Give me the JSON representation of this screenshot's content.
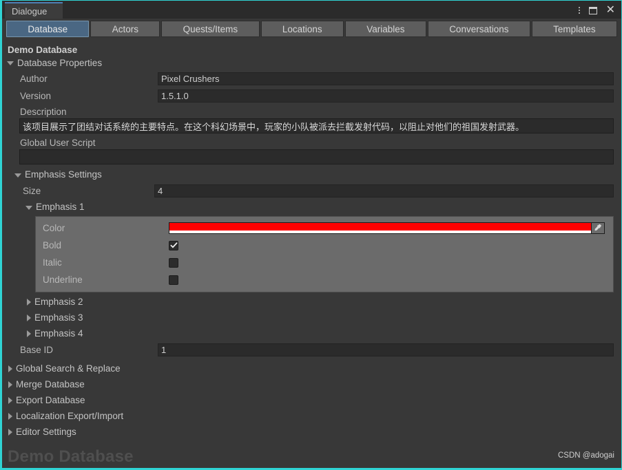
{
  "window": {
    "tab_label": "Dialogue",
    "controls": {
      "menu_icon": "kebab-menu-icon",
      "maximize_icon": "maximize-icon",
      "close_icon": "close-icon"
    }
  },
  "tabs": [
    {
      "label": "Database",
      "active": true
    },
    {
      "label": "Actors",
      "active": false
    },
    {
      "label": "Quests/Items",
      "active": false
    },
    {
      "label": "Locations",
      "active": false
    },
    {
      "label": "Variables",
      "active": false
    },
    {
      "label": "Conversations",
      "active": false
    },
    {
      "label": "Templates",
      "active": false
    }
  ],
  "database": {
    "title": "Demo Database",
    "properties_foldout": "Database Properties",
    "author": {
      "label": "Author",
      "value": "Pixel Crushers"
    },
    "version": {
      "label": "Version",
      "value": "1.5.1.0"
    },
    "description": {
      "label": "Description",
      "value": "该项目展示了团结对话系统的主要特点。在这个科幻场景中，玩家的小队被派去拦截发射代码，以阻止对他们的祖国发射武器。"
    },
    "global_user_script": {
      "label": "Global User Script",
      "value": ""
    },
    "base_id": {
      "label": "Base ID",
      "value": "1"
    }
  },
  "emphasis_settings": {
    "foldout": "Emphasis Settings",
    "size": {
      "label": "Size",
      "value": "4"
    },
    "emphasis_1": {
      "foldout": "Emphasis 1",
      "color": {
        "label": "Color",
        "value": "#FF0000",
        "alpha_hex": "#FFFFFF"
      },
      "bold": {
        "label": "Bold",
        "checked": true
      },
      "italic": {
        "label": "Italic",
        "checked": false
      },
      "underline": {
        "label": "Underline",
        "checked": false
      },
      "eyedropper_icon": "eyedropper-icon"
    },
    "collapsed": [
      {
        "foldout": "Emphasis 2"
      },
      {
        "foldout": "Emphasis 3"
      },
      {
        "foldout": "Emphasis 4"
      }
    ]
  },
  "bottom_sections": [
    {
      "label": "Global Search & Replace"
    },
    {
      "label": "Merge Database"
    },
    {
      "label": "Export Database"
    },
    {
      "label": "Localization Export/Import"
    },
    {
      "label": "Editor Settings"
    }
  ],
  "watermarks": {
    "background_title": "Demo Database",
    "credit": "CSDN @adogai"
  },
  "colors": {
    "accent_border": "#2fd4d4",
    "tab_active": "#4a6783",
    "panel_grey": "#6b6b6b",
    "window_bg": "#383838",
    "field_dark": "#2b2b2b",
    "emphasis_1_color": "#FF0000"
  }
}
